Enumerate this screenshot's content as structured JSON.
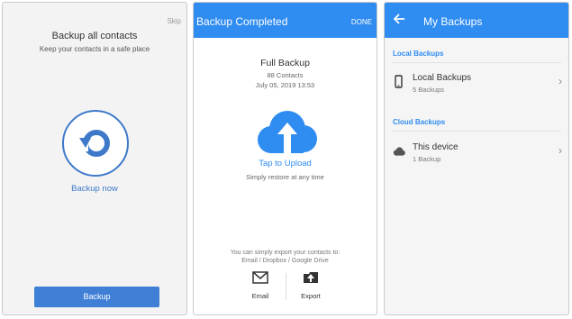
{
  "screen1": {
    "skip": "Skip",
    "title": "Backup all contacts",
    "subtitle": "Keep your contacts in a safe place",
    "backup_now": "Backup now",
    "button": "Backup",
    "icon": "restore-arrow-icon",
    "accent": "#3e79c9"
  },
  "screen2": {
    "title": "Backup Completed",
    "done": "DONE",
    "heading": "Full Backup",
    "contacts": "88 Contacts",
    "date": "July 05, 2019 13:53",
    "tap_upload": "Tap to Upload",
    "restore_note": "Simply restore at any time",
    "export_line1": "You can simply export your contacts to:",
    "export_line2": "Email / Dropbox / Google Drive",
    "actions": [
      {
        "label": "Email",
        "icon": "email-icon"
      },
      {
        "label": "Export",
        "icon": "export-icon"
      }
    ],
    "accent": "#2f8cf0"
  },
  "screen3": {
    "title": "My Backups",
    "local_section": "Local Backups",
    "local_row": {
      "title": "Local Backups",
      "sub": "5 Backups",
      "icon": "phone-icon"
    },
    "cloud_section": "Cloud Backups",
    "cloud_row": {
      "title": "This device",
      "sub": "1 Backup",
      "icon": "cloud-icon"
    }
  }
}
